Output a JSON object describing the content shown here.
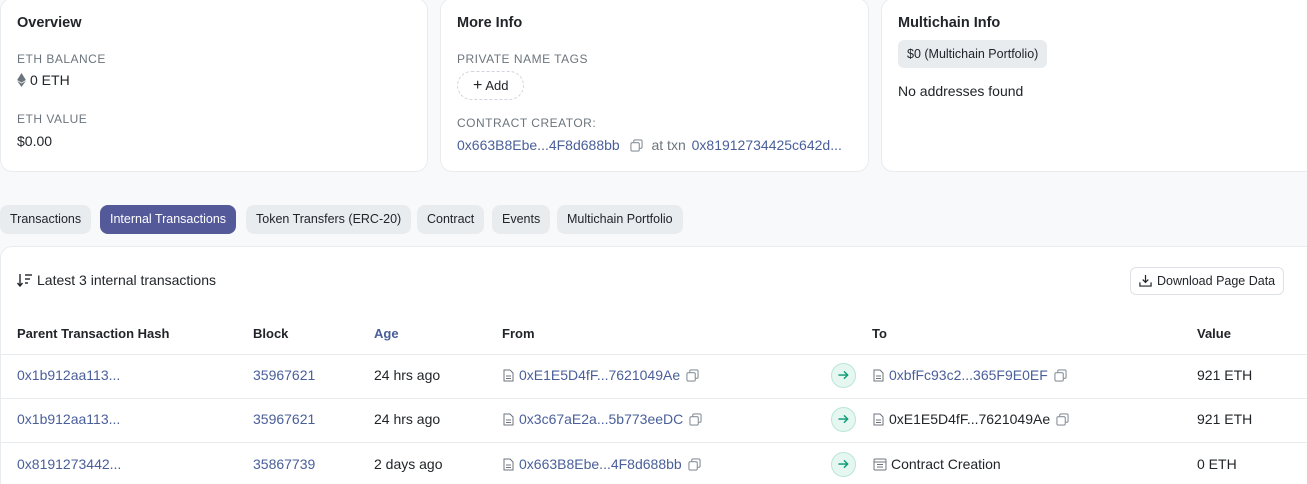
{
  "overview": {
    "title": "Overview",
    "balance_label": "ETH BALANCE",
    "balance_value": "0 ETH",
    "value_label": "ETH VALUE",
    "value_amount": "$0.00"
  },
  "more_info": {
    "title": "More Info",
    "tags_label": "PRIVATE NAME TAGS",
    "add_label": "Add",
    "creator_label": "CONTRACT CREATOR:",
    "creator_address": "0x663B8Ebe...4F8d688bb",
    "at_txn_text": "at txn",
    "creator_txn": "0x81912734425c642d..."
  },
  "multichain": {
    "title": "Multichain Info",
    "portfolio_badge": "$0 (Multichain Portfolio)",
    "empty_text": "No addresses found"
  },
  "tabs": [
    {
      "label": "Transactions",
      "active": false
    },
    {
      "label": "Internal Transactions",
      "active": true
    },
    {
      "label": "Token Transfers (ERC-20)",
      "active": false
    },
    {
      "label": "Contract",
      "active": false
    },
    {
      "label": "Events",
      "active": false
    },
    {
      "label": "Multichain Portfolio",
      "active": false
    }
  ],
  "internal": {
    "summary": "Latest 3 internal transactions",
    "download_label": "Download Page Data",
    "columns": {
      "parent_hash": "Parent Transaction Hash",
      "block": "Block",
      "age": "Age",
      "from": "From",
      "to": "To",
      "value": "Value"
    },
    "rows": [
      {
        "parent_hash": "0x1b912aa113...",
        "block": "35967621",
        "age": "24 hrs ago",
        "from": "0xE1E5D4fF...7621049Ae",
        "to": "0xbfFc93c2...365F9E0EF",
        "value": "921 ETH"
      },
      {
        "parent_hash": "0x1b912aa113...",
        "block": "35967621",
        "age": "24 hrs ago",
        "from": "0x3c67aE2a...5b773eeDC",
        "to": "0xE1E5D4fF...7621049Ae",
        "value": "921 ETH"
      },
      {
        "parent_hash": "0x8191273442...",
        "block": "35867739",
        "age": "2 days ago",
        "from": "0x663B8Ebe...4F8d688bb",
        "to": "Contract Creation",
        "value": "0 ETH"
      }
    ]
  },
  "colors": {
    "accent": "#54599a",
    "link": "#4a5f9a",
    "arrow_badge": "#e6f6f1",
    "arrow": "#0f9d77"
  }
}
